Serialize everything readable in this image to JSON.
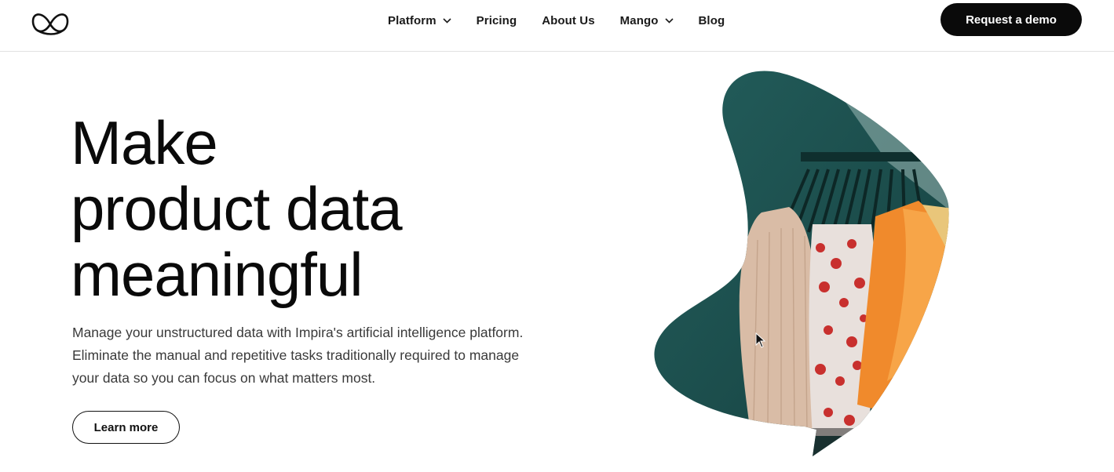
{
  "header": {
    "logo": {
      "icon": "impira-logo-icon"
    },
    "nav": [
      {
        "label": "Platform",
        "has_dropdown": true
      },
      {
        "label": "Pricing",
        "has_dropdown": false
      },
      {
        "label": "About Us",
        "has_dropdown": false
      },
      {
        "label": "Mango",
        "has_dropdown": true
      },
      {
        "label": "Blog",
        "has_dropdown": false
      }
    ],
    "cta_label": "Request a demo"
  },
  "hero": {
    "headline": [
      "Make",
      "product data",
      "meaningful"
    ],
    "description": "Manage your unstructured data with Impira's artificial intelligence platform. Eliminate the manual and repetitive tasks traditionally required to manage your data so you can focus on what matters most.",
    "learn_more_label": "Learn more",
    "image": {
      "icon": "clothing-rack-image"
    }
  },
  "colors": {
    "primary_button": "#0a0a0a",
    "blob_background": "#1f5554",
    "text": "#111111"
  }
}
